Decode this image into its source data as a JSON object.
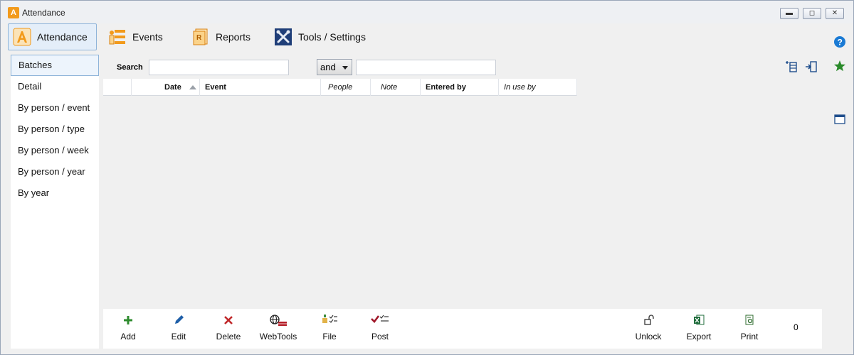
{
  "window": {
    "title": "Attendance",
    "app_icon_text": "A",
    "controls": {
      "minimize": "▬",
      "maximize": "◻",
      "close": "✕"
    }
  },
  "topnav": {
    "items": [
      {
        "label": "Attendance",
        "icon": "attendance-icon",
        "active": true
      },
      {
        "label": "Events",
        "icon": "events-icon",
        "active": false
      },
      {
        "label": "Reports",
        "icon": "reports-icon",
        "active": false
      },
      {
        "label": "Tools / Settings",
        "icon": "tools-icon",
        "active": false
      }
    ]
  },
  "sidebar": {
    "items": [
      {
        "label": "Batches",
        "active": true
      },
      {
        "label": "Detail"
      },
      {
        "label": "By person / event"
      },
      {
        "label": "By person / type"
      },
      {
        "label": "By person / week"
      },
      {
        "label": "By person / year"
      },
      {
        "label": "By year"
      }
    ]
  },
  "search": {
    "label": "Search",
    "value1": "",
    "operator": "and",
    "value2": ""
  },
  "grid": {
    "columns": [
      "Date",
      "Event",
      "People",
      "Note",
      "Entered by",
      "In use by"
    ]
  },
  "bottombar": {
    "buttons": [
      {
        "label": "Add",
        "icon": "plus-icon"
      },
      {
        "label": "Edit",
        "icon": "pencil-icon"
      },
      {
        "label": "Delete",
        "icon": "x-icon"
      },
      {
        "label": "WebTools",
        "icon": "globe-icon"
      },
      {
        "label": "File",
        "icon": "file-checklist-icon"
      },
      {
        "label": "Post",
        "icon": "check-post-icon"
      },
      {
        "label": "Unlock",
        "icon": "lock-icon"
      },
      {
        "label": "Export",
        "icon": "excel-icon"
      },
      {
        "label": "Print",
        "icon": "print-icon"
      }
    ],
    "count": "0"
  },
  "colors": {
    "accent": "#f29a1b",
    "active_border": "#8eb4d9",
    "help": "#1a7ad4",
    "star": "#2a8a2a",
    "add": "#2e8b2e",
    "delete": "#c0282a",
    "post": "#a0182a"
  }
}
